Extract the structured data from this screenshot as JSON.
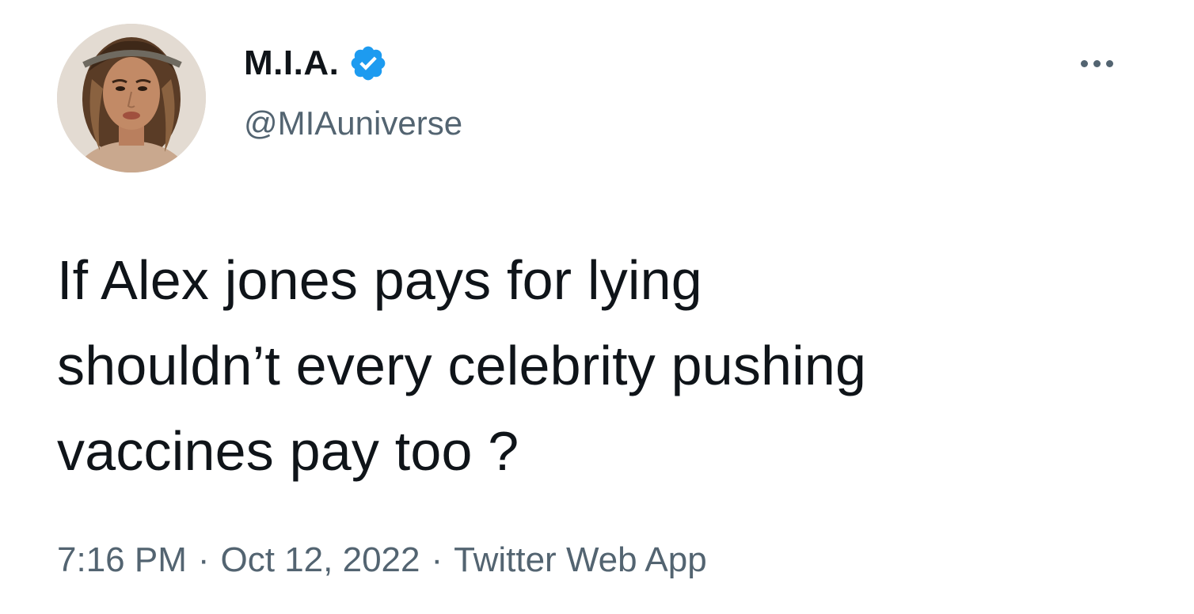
{
  "author": {
    "display_name": "M.I.A.",
    "handle": "@MIAuniverse",
    "verified": true,
    "avatar_icon": "profile-photo"
  },
  "tweet": {
    "text": "If Alex jones pays for lying\nshouldn’t every celebrity pushing\nvaccines pay too ?"
  },
  "meta": {
    "time": "7:16 PM",
    "separator": "·",
    "date": "Oct 12, 2022",
    "source": "Twitter Web App"
  },
  "icons": {
    "verified": "verified-badge-icon",
    "more": "more-options-icon"
  },
  "colors": {
    "text_primary": "#0f1419",
    "text_secondary": "#536471",
    "verified_blue": "#1d9bf0",
    "background": "#ffffff"
  }
}
